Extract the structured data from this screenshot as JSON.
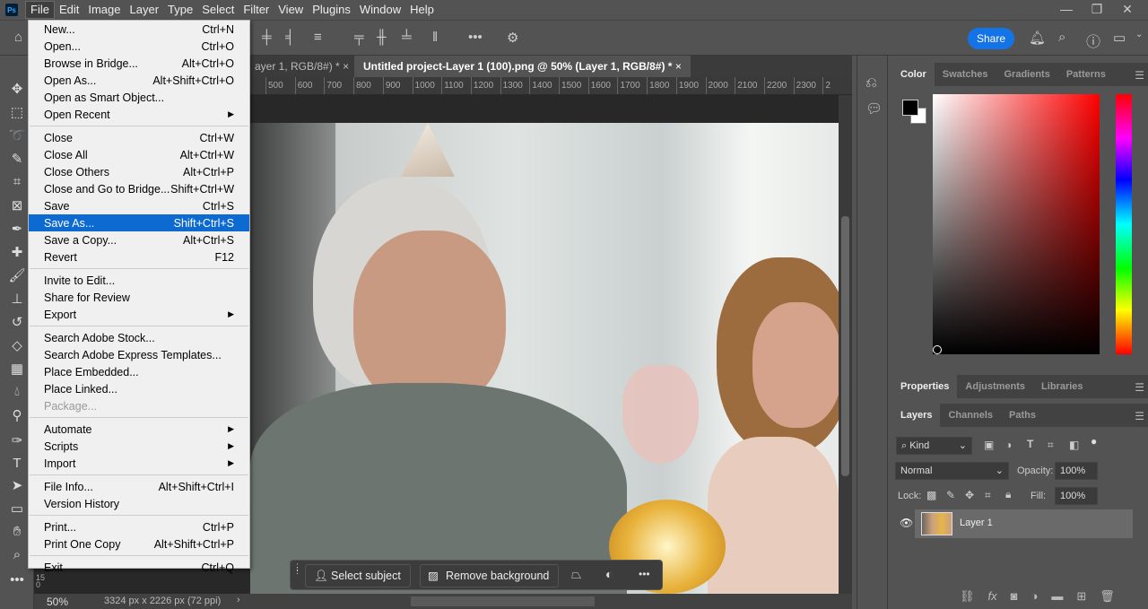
{
  "menubar": {
    "logo": "Ps",
    "items": [
      "File",
      "Edit",
      "Image",
      "Layer",
      "Type",
      "Select",
      "Filter",
      "View",
      "Plugins",
      "Window",
      "Help"
    ]
  },
  "window_controls": {
    "minimize": "—",
    "restore": "❐",
    "close": "✕"
  },
  "optionsbar": {
    "share": "Share"
  },
  "tabs": [
    {
      "label": "ayer 1, RGB/8#) *"
    },
    {
      "label": "Untitled project-Layer 1 (100).png @ 50% (Layer 1, RGB/8#) *"
    }
  ],
  "tab_close": "×",
  "ruler": [
    "500",
    "600",
    "700",
    "800",
    "900",
    "1000",
    "1100",
    "1200",
    "1300",
    "1400",
    "1500",
    "1600",
    "1700",
    "1800",
    "1900",
    "2000",
    "2100",
    "2200",
    "2300",
    "2"
  ],
  "vruler": "150",
  "status": {
    "zoom": "50%",
    "doc_info": "3324 px x 2226 px (72 ppi)"
  },
  "context_bar": {
    "select_subject": "Select subject",
    "remove_background": "Remove background"
  },
  "file_menu": [
    {
      "label": "New...",
      "shortcut": "Ctrl+N"
    },
    {
      "label": "Open...",
      "shortcut": "Ctrl+O"
    },
    {
      "label": "Browse in Bridge...",
      "shortcut": "Alt+Ctrl+O"
    },
    {
      "label": "Open As...",
      "shortcut": "Alt+Shift+Ctrl+O"
    },
    {
      "label": "Open as Smart Object...",
      "shortcut": ""
    },
    {
      "label": "Open Recent",
      "shortcut": "",
      "submenu": true
    },
    {
      "sep": true
    },
    {
      "label": "Close",
      "shortcut": "Ctrl+W"
    },
    {
      "label": "Close All",
      "shortcut": "Alt+Ctrl+W"
    },
    {
      "label": "Close Others",
      "shortcut": "Alt+Ctrl+P"
    },
    {
      "label": "Close and Go to Bridge...",
      "shortcut": "Shift+Ctrl+W"
    },
    {
      "label": "Save",
      "shortcut": "Ctrl+S"
    },
    {
      "label": "Save As...",
      "shortcut": "Shift+Ctrl+S",
      "highlighted": true
    },
    {
      "label": "Save a Copy...",
      "shortcut": "Alt+Ctrl+S"
    },
    {
      "label": "Revert",
      "shortcut": "F12"
    },
    {
      "sep": true
    },
    {
      "label": "Invite to Edit...",
      "shortcut": ""
    },
    {
      "label": "Share for Review",
      "shortcut": ""
    },
    {
      "label": "Export",
      "shortcut": "",
      "submenu": true
    },
    {
      "sep": true
    },
    {
      "label": "Search Adobe Stock...",
      "shortcut": ""
    },
    {
      "label": "Search Adobe Express Templates...",
      "shortcut": ""
    },
    {
      "label": "Place Embedded...",
      "shortcut": ""
    },
    {
      "label": "Place Linked...",
      "shortcut": ""
    },
    {
      "label": "Package...",
      "shortcut": "",
      "disabled": true
    },
    {
      "sep": true
    },
    {
      "label": "Automate",
      "shortcut": "",
      "submenu": true
    },
    {
      "label": "Scripts",
      "shortcut": "",
      "submenu": true
    },
    {
      "label": "Import",
      "shortcut": "",
      "submenu": true
    },
    {
      "sep": true
    },
    {
      "label": "File Info...",
      "shortcut": "Alt+Shift+Ctrl+I"
    },
    {
      "label": "Version History",
      "shortcut": ""
    },
    {
      "sep": true
    },
    {
      "label": "Print...",
      "shortcut": "Ctrl+P"
    },
    {
      "label": "Print One Copy",
      "shortcut": "Alt+Shift+Ctrl+P"
    },
    {
      "sep": true
    },
    {
      "label": "Exit",
      "shortcut": "Ctrl+Q"
    }
  ],
  "color_panel": {
    "tabs": [
      "Color",
      "Swatches",
      "Gradients",
      "Patterns"
    ],
    "hue_color": "#ff0000"
  },
  "properties_panel": {
    "tabs": [
      "Properties",
      "Adjustments",
      "Libraries"
    ]
  },
  "layers_panel": {
    "tabs": [
      "Layers",
      "Channels",
      "Paths"
    ],
    "filter": "Kind",
    "blend_mode": "Normal",
    "opacity_label": "Opacity:",
    "opacity": "100%",
    "lock_label": "Lock:",
    "fill_label": "Fill:",
    "fill": "100%",
    "layers": [
      {
        "name": "Layer 1",
        "visible": true
      }
    ]
  }
}
